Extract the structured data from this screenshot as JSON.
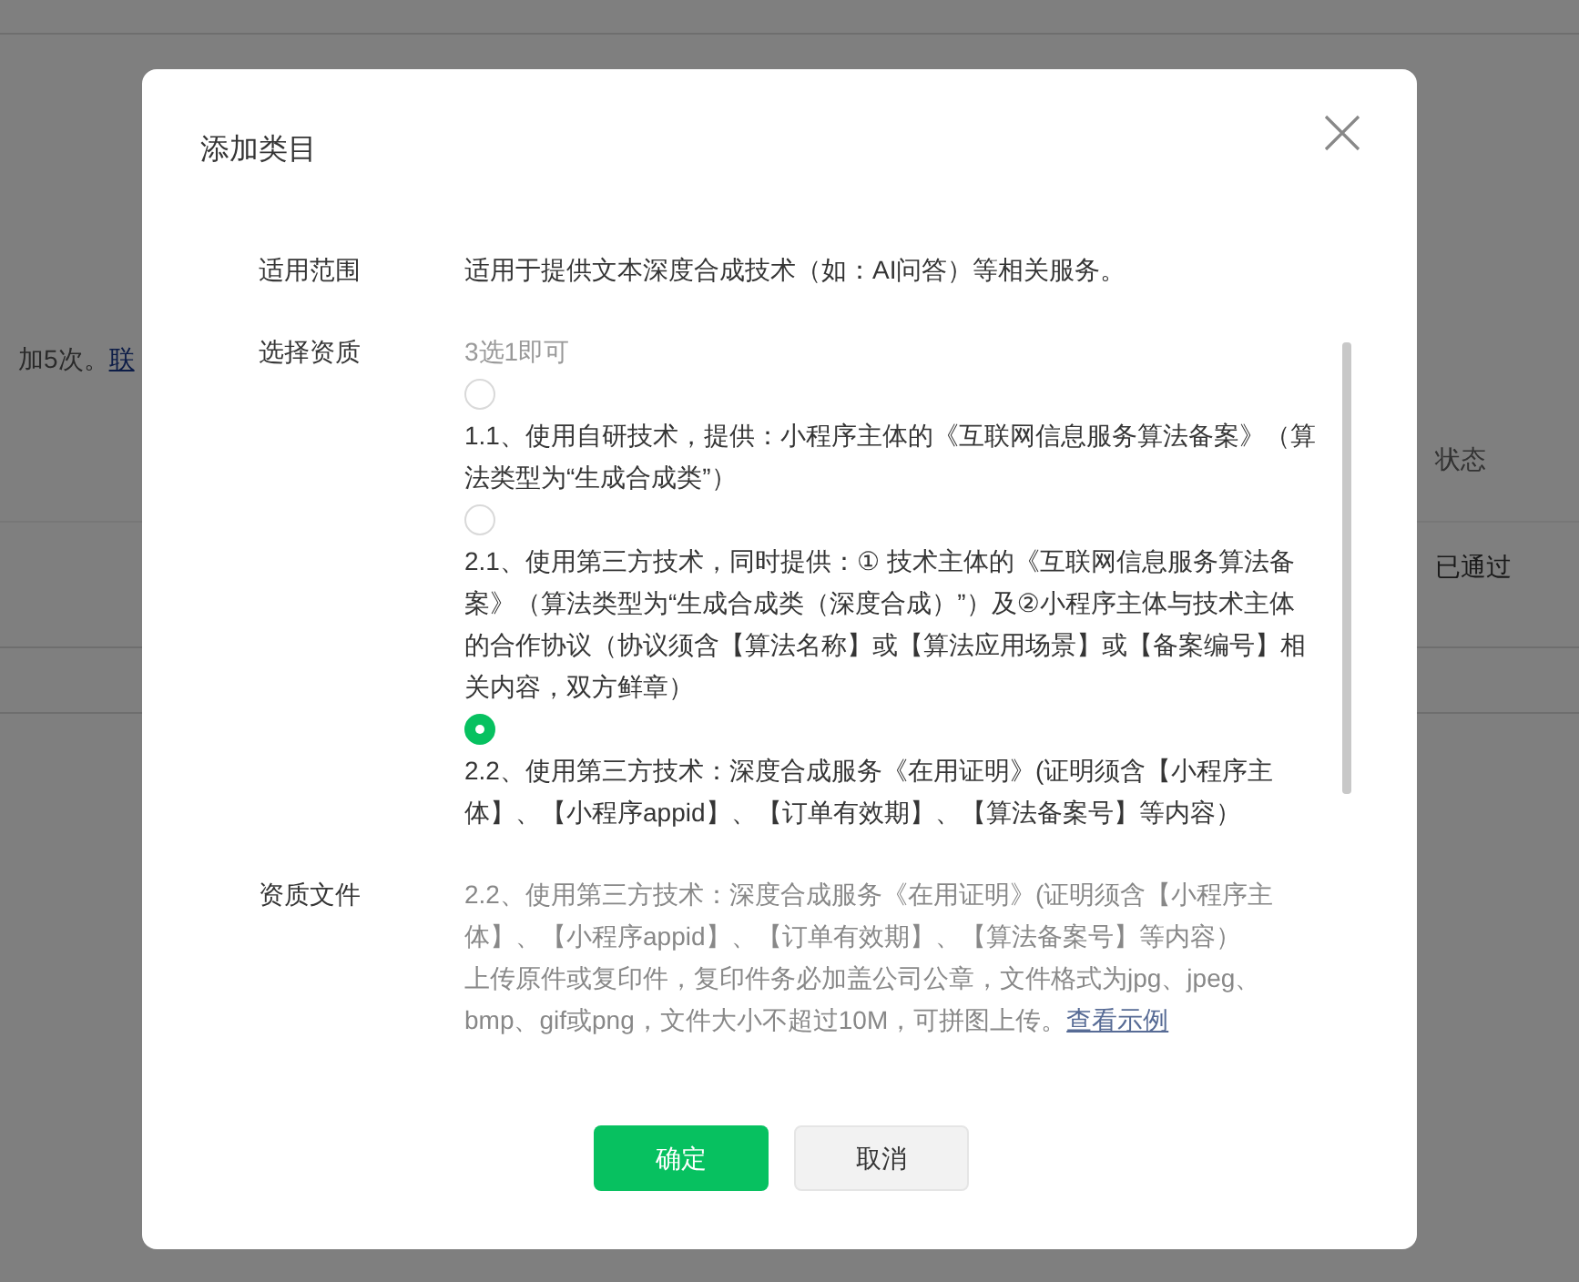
{
  "background": {
    "notice_text": "加5次。",
    "notice_link": "联",
    "status_header": "状态",
    "status_value": "已通过"
  },
  "dialog": {
    "title": "添加类目",
    "fields": [
      {
        "kind": "text",
        "label": "适用范围",
        "text": "适用于提供文本深度合成技术（如：AI问答）等相关服务。"
      },
      {
        "kind": "radio",
        "label": "选择资质",
        "hint": "3选1即可",
        "options": [
          {
            "text": "1.1、使用自研技术，提供：小程序主体的《互联网信息服务算法备案》（算法类型为“生成合成类”）",
            "selected": false
          },
          {
            "text": "2.1、使用第三方技术，同时提供：① 技术主体的《互联网信息服务算法备案》（算法类型为“生成合成类（深度合成）”）及②小程序主体与技术主体的合作协议（协议须含【算法名称】或【算法应用场景】或【备案编号】相关内容，双方鲜章）",
            "selected": false
          },
          {
            "text": "2.2、使用第三方技术：深度合成服务《在用证明》(证明须含【小程序主体】、【小程序appid】、【订单有效期】、【算法备案号】等内容）",
            "selected": true
          }
        ]
      },
      {
        "kind": "note",
        "label": "资质文件",
        "text": "2.2、使用第三方技术：深度合成服务《在用证明》(证明须含【小程序主体】、【小程序appid】、【订单有效期】、【算法备案号】等内容）",
        "note": "上传原件或复印件，复印件务必加盖公司公章，文件格式为jpg、jpeg、bmp、gif或png，文件大小不超过10M，可拼图上传。",
        "link": "查看示例"
      }
    ],
    "buttons": [
      {
        "kind": "primary",
        "label": "确定"
      },
      {
        "kind": "secondary",
        "label": "取消"
      }
    ]
  }
}
